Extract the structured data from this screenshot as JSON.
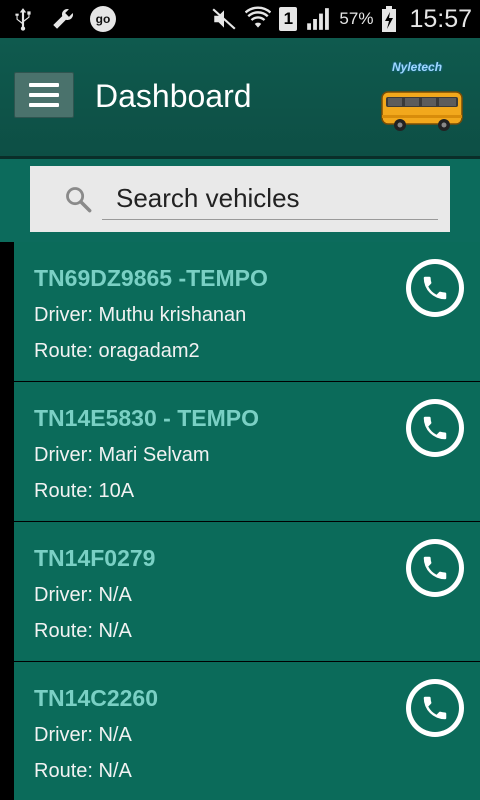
{
  "status_bar": {
    "icons": [
      "usb-icon",
      "wrench-icon",
      "go-badge",
      "mute-icon",
      "wifi-icon",
      "sim-1-icon",
      "signal-icon",
      "battery-charging-icon"
    ],
    "go_label": "go",
    "sim_label": "1",
    "battery_percent": "57%",
    "time": "15:57"
  },
  "header": {
    "title": "Dashboard",
    "menu_icon": "hamburger-menu-icon",
    "logo_text": "Nyletech",
    "bus_icon": "bus-icon"
  },
  "search": {
    "placeholder": "Search vehicles",
    "value": "",
    "icon": "search-icon"
  },
  "vehicles": [
    {
      "plate": "TN69DZ9865 -TEMPO",
      "driver": "Driver: Muthu krishanan",
      "route": "Route: oragadam2"
    },
    {
      "plate": "TN14E5830 - TEMPO",
      "driver": "Driver: Mari Selvam",
      "route": "Route: 10A"
    },
    {
      "plate": "TN14F0279",
      "driver": "Driver: N/A",
      "route": "Route: N/A"
    },
    {
      "plate": "TN14C2260",
      "driver": "Driver: N/A",
      "route": "Route: N/A"
    }
  ],
  "colors": {
    "header_bg": "#0f5a4e",
    "list_bg": "#0b6b5a",
    "plate_text": "#7ad0c4",
    "search_bg": "#e9e9e9"
  }
}
